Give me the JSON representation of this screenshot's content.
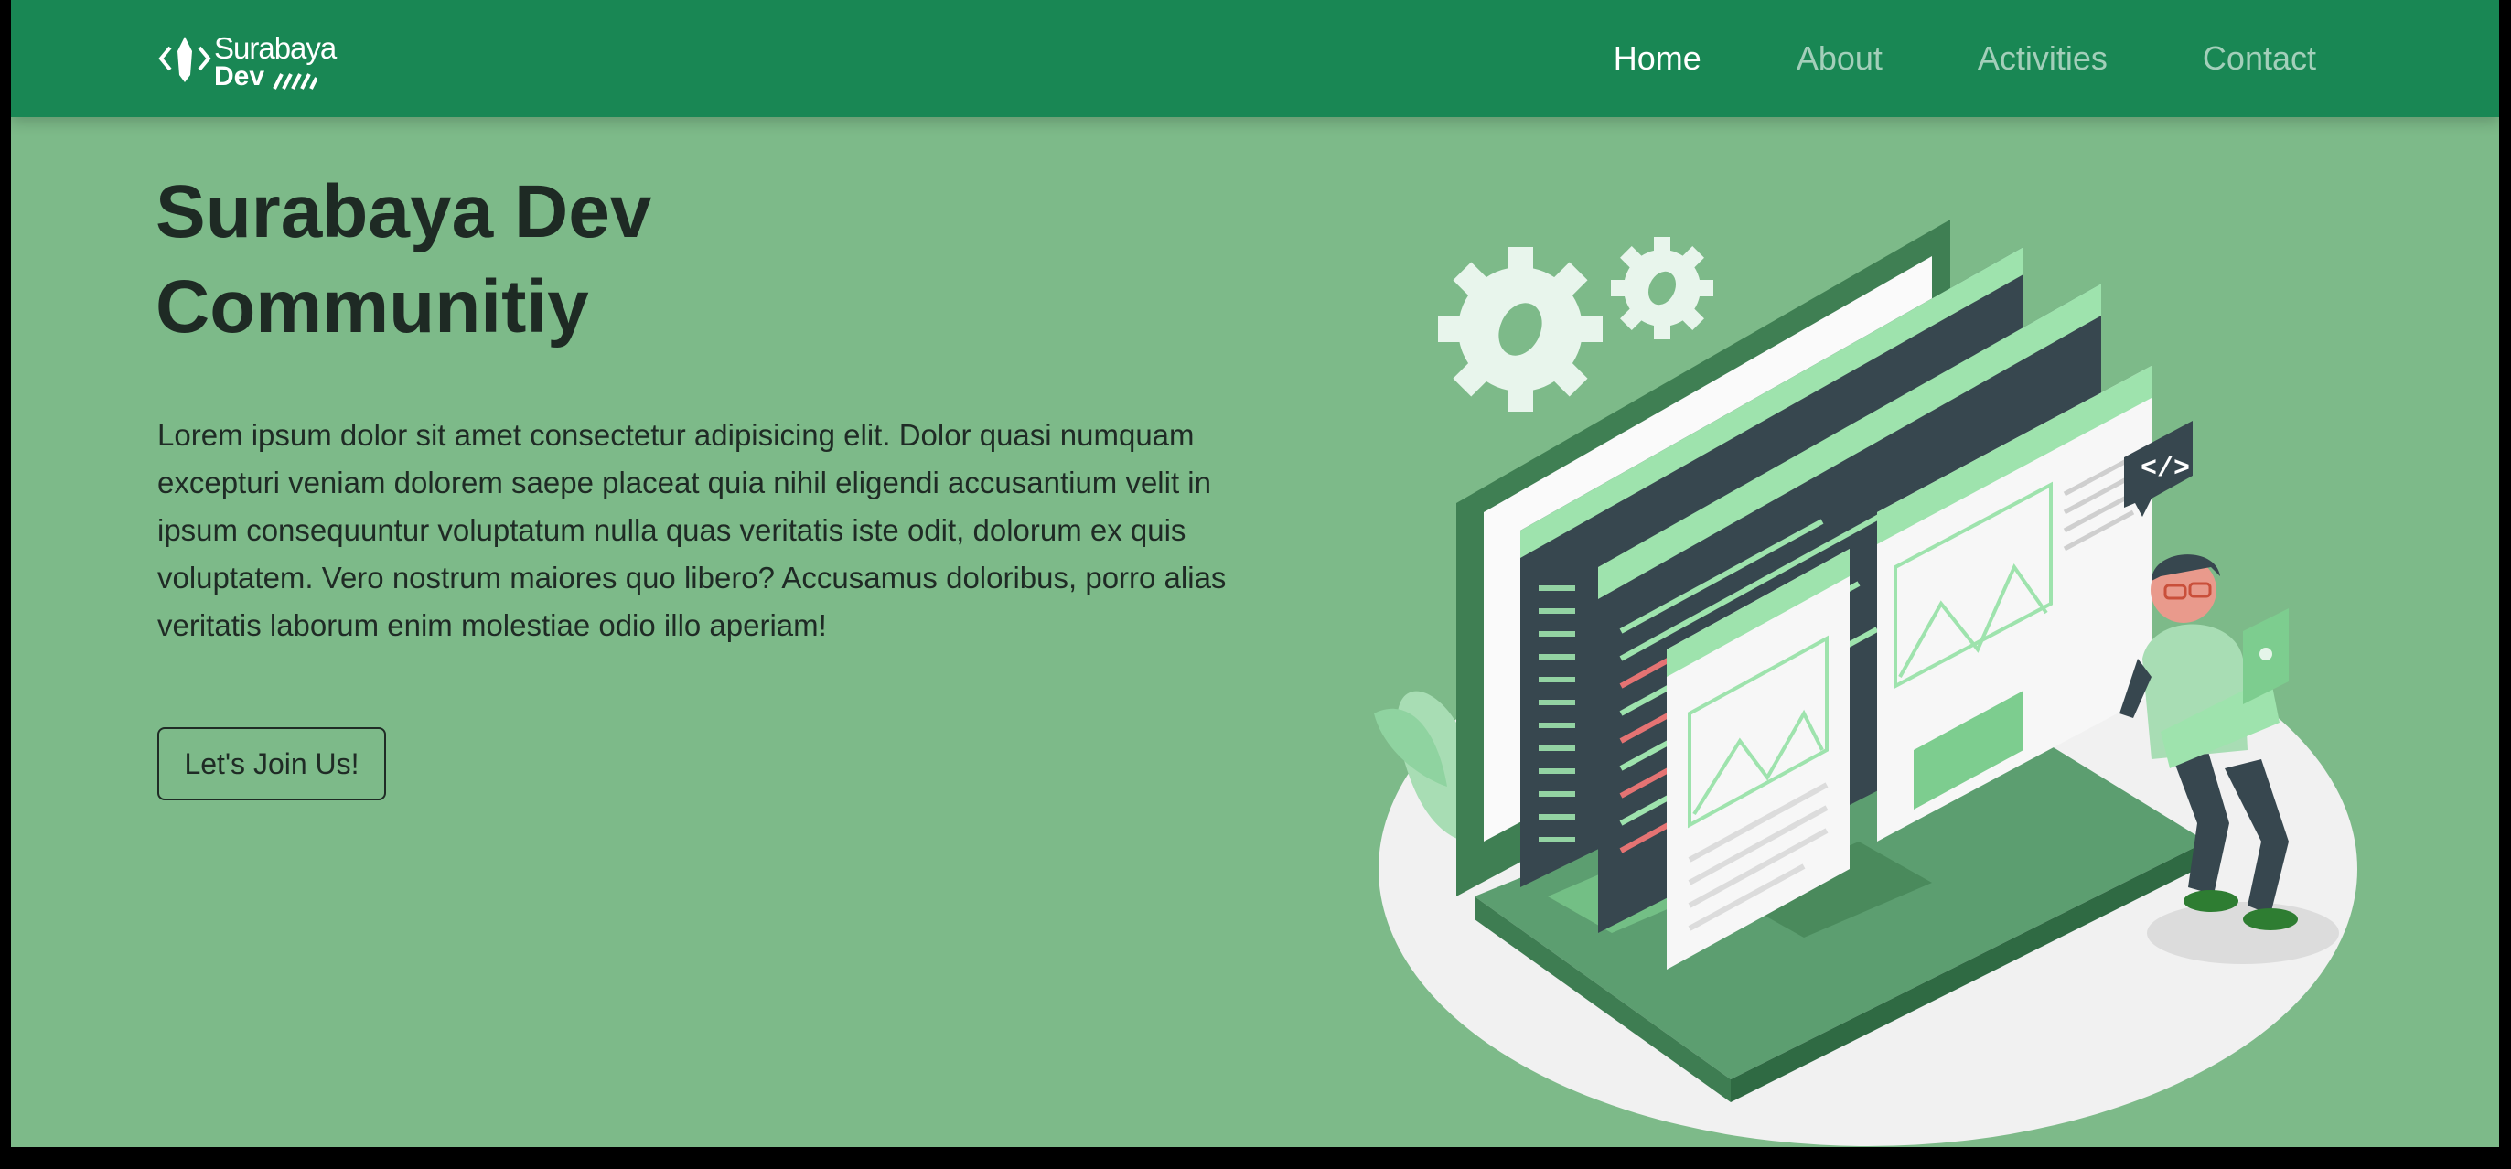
{
  "brand": {
    "line1": "Surabaya",
    "line2": "Dev"
  },
  "nav": {
    "home": "Home",
    "about": "About",
    "activities": "Activities",
    "contact": "Contact"
  },
  "hero": {
    "title_line1": "Surabaya Dev",
    "title_line2": "Communitiy",
    "text": "Lorem ipsum dolor sit amet consectetur adipisicing elit. Dolor quasi numquam excepturi veniam dolorem saepe placeat quia nihil eligendi accusantium velit in ipsum consequuntur voluptatum nulla quas veritatis iste odit, dolorum ex quis voluptatem. Vero nostrum maiores quo libero? Accusamus doloribus, porro alias veritatis laborum enim molestiae odio illo aperiam!",
    "button": "Let's Join Us!",
    "code_tag": "</>"
  },
  "colors": {
    "navbar": "#198754",
    "background": "#7dba89",
    "accent_light": "#9ee3ad",
    "dark_panel": "#37474f"
  },
  "icons": [
    "brand-logo-icon",
    "gear-icon",
    "code-tag-icon",
    "image-placeholder-icon"
  ]
}
